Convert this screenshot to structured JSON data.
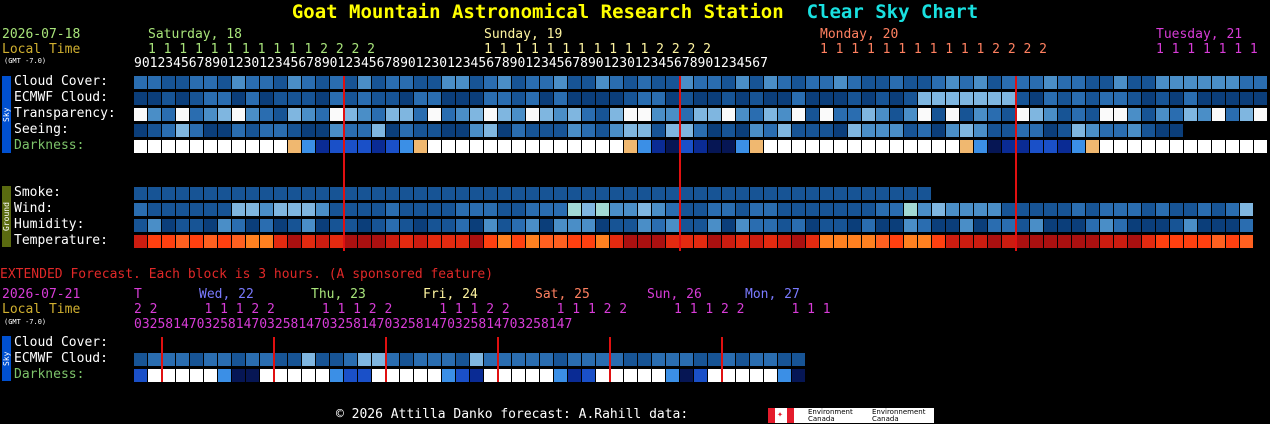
{
  "title": {
    "station": "Goat Mountain Astronomical Research Station",
    "chart": "Clear Sky Chart"
  },
  "main": {
    "date": "2026-07-18",
    "local_time": "Local Time",
    "gmt": "(GMT -7.0)",
    "days": [
      {
        "label": "Saturday, 18",
        "color": "#a8e47a"
      },
      {
        "label": "Sunday, 19",
        "color": "#fff5a0"
      },
      {
        "label": "Monday, 20",
        "color": "#ff8060"
      },
      {
        "label": "Tuesday, 21",
        "color": "#d83cd8"
      }
    ],
    "tens": [
      "1 1 1 1 1 1 1 1 1 1 1 2 2 2 2",
      "1 1 1 1 1 1 1 1 1 1 1 2 2 2 2",
      "1 1 1 1 1 1 1 1 1 1 1 2 2 2 2",
      "1 1 1 1 1 1 1"
    ],
    "hours": "901234567890123012345678901234567890123012345678901234567890123012345678901234567",
    "sky_labels": [
      "Cloud Cover:",
      "ECMWF Cloud:",
      "Transparency:",
      "Seeing:",
      "Darkness:"
    ],
    "ground_labels": [
      "Smoke:",
      "Wind:",
      "Humidity:",
      "Temperature:"
    ],
    "sky_side": "Sky",
    "ground_side": "Ground"
  },
  "extended": {
    "heading": "EXTENDED Forecast. Each block is 3 hours. (A sponsored feature)",
    "date": "2026-07-21",
    "local_time": "Local Time",
    "gmt": "(GMT -7.0)",
    "days": [
      {
        "label": "T",
        "color": "#d83cd8"
      },
      {
        "label": "Wed, 22",
        "color": "#7a7aff"
      },
      {
        "label": "Thu, 23",
        "color": "#a8e47a"
      },
      {
        "label": "Fri, 24",
        "color": "#fff5a0"
      },
      {
        "label": "Sat, 25",
        "color": "#ff8060"
      },
      {
        "label": "Sun, 26",
        "color": "#d83cd8"
      },
      {
        "label": "Mon, 27",
        "color": "#7a7aff"
      }
    ],
    "tens": "2 2      1 1 1 2 2      1 1 1 2 2      1 1 1 2 2      1 1 1 2 2      1 1 1 2 2      1 1 1",
    "hours": "03258147032581470325814703258147032581470325814703258147",
    "labels": [
      "Cloud Cover:",
      "ECMWF Cloud:",
      "Darkness:"
    ],
    "side": "Sky"
  },
  "footer": {
    "text": "© 2026 Attilla Danko  forecast: A.Rahill  data:",
    "env_en": "Environment Canada",
    "env_fr": "Environnement Canada"
  },
  "colors": {
    "cloud": [
      "#0b3e7a",
      "#175495",
      "#2a6db0",
      "#4a8ec7",
      "#7fb6e0",
      "#a2d9d4",
      "#c0c0c0",
      "#fafafa"
    ],
    "seeing": [
      "#0b3e7a",
      "#175495",
      "#2a6db0",
      "#4a8ec7",
      "#7fb6e0"
    ],
    "dark": [
      "#000000",
      "#061654",
      "#0a2b94",
      "#1a50c8",
      "#3b8fe6",
      "#f0b870",
      "#ffe0a8",
      "#fff8e6",
      "#ffffff"
    ],
    "temp": [
      "#aa1010",
      "#cc1c10",
      "#e32a10",
      "#ff4010",
      "#ff6020",
      "#ff8020"
    ]
  }
}
